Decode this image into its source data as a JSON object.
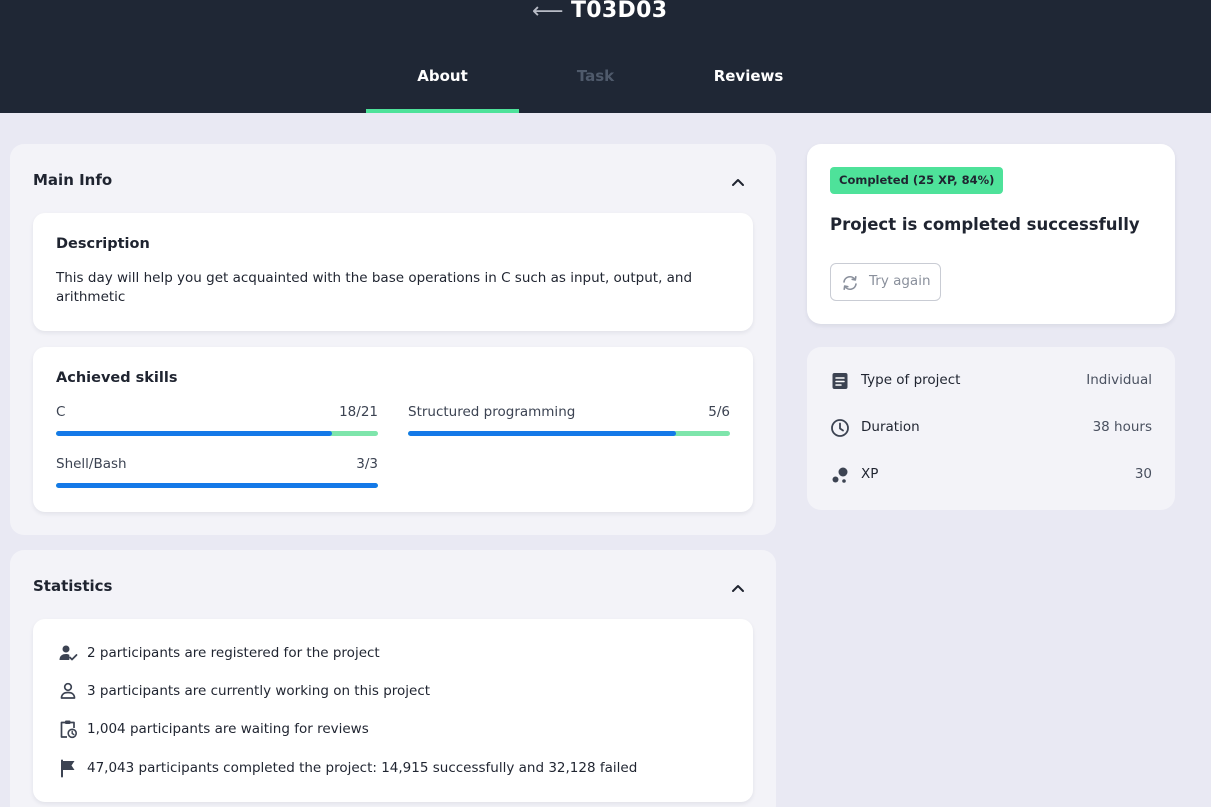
{
  "header": {
    "back_icon": "arrow-left-icon",
    "title": "T03D03",
    "tabs": [
      {
        "label": "About",
        "state": "active"
      },
      {
        "label": "Task",
        "state": "disabled"
      },
      {
        "label": "Reviews",
        "state": "normal"
      }
    ]
  },
  "main_info": {
    "title": "Main Info",
    "description": {
      "heading": "Description",
      "text": "This day will help you get acquainted with the base operations in C such as input, output, and arithmetic"
    },
    "skills": {
      "heading": "Achieved skills",
      "items": [
        {
          "name": "C",
          "value": "18/21",
          "fraction": 0.857
        },
        {
          "name": "Structured programming",
          "value": "5/6",
          "fraction": 0.833
        },
        {
          "name": "Shell/Bash",
          "value": "3/3",
          "fraction": 1.0
        }
      ]
    }
  },
  "statistics": {
    "title": "Statistics",
    "items": [
      {
        "icon": "user-check-icon",
        "text": "2 participants are registered for the project"
      },
      {
        "icon": "user-icon",
        "text": "3 participants are currently working on this project"
      },
      {
        "icon": "clipboard-clock-icon",
        "text": "1,004 participants are waiting for reviews"
      },
      {
        "icon": "flag-icon",
        "text": "47,043 participants completed the project: 14,915 successfully and 32,128 failed"
      }
    ]
  },
  "status": {
    "badge": "Completed (25 XP, 84%)",
    "title": "Project is completed successfully",
    "try_again": "Try again"
  },
  "project_info": [
    {
      "icon": "document-icon",
      "label": "Type of project",
      "value": "Individual"
    },
    {
      "icon": "clock-icon",
      "label": "Duration",
      "value": "38 hours"
    },
    {
      "icon": "xp-dots-icon",
      "label": "XP",
      "value": "30"
    }
  ],
  "colors": {
    "header_bg": "#1f2735",
    "accent_green": "#4ee29a",
    "progress_blue": "#1479e8",
    "page_bg": "#e9e9f3"
  }
}
